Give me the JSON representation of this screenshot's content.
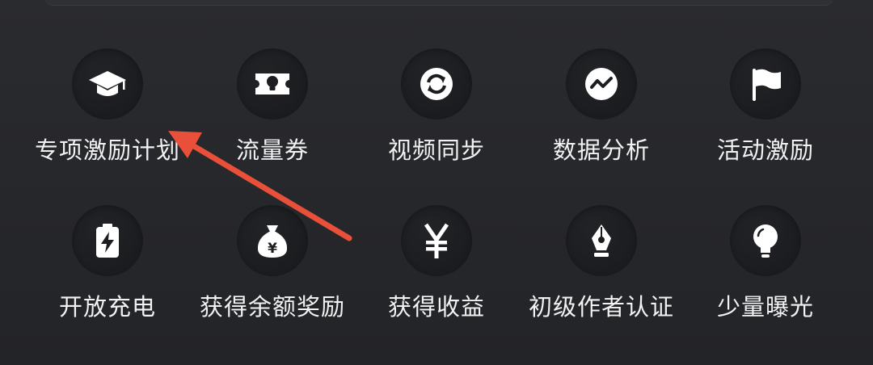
{
  "colors": {
    "background": "#26272b",
    "icon_circle": "#1c1d20",
    "icon_glyph": "#ffffff",
    "label_text": "#f2f2f2",
    "annotation_arrow": "#e8503a"
  },
  "grid": {
    "row1": [
      {
        "label": "专项激励计划",
        "icon": "graduation-cap-icon"
      },
      {
        "label": "流量券",
        "icon": "ticket-bulb-icon"
      },
      {
        "label": "视频同步",
        "icon": "sync-icon"
      },
      {
        "label": "数据分析",
        "icon": "line-chart-icon"
      },
      {
        "label": "活动激励",
        "icon": "flag-icon"
      }
    ],
    "row2": [
      {
        "label": "开放充电",
        "icon": "battery-charging-icon"
      },
      {
        "label": "获得余额奖励",
        "icon": "money-bag-icon"
      },
      {
        "label": "获得收益",
        "icon": "yen-icon"
      },
      {
        "label": "初级作者认证",
        "icon": "pen-nib-icon"
      },
      {
        "label": "少量曝光",
        "icon": "light-bulb-icon"
      }
    ]
  },
  "annotation": {
    "icon": "red-arrow-icon"
  }
}
